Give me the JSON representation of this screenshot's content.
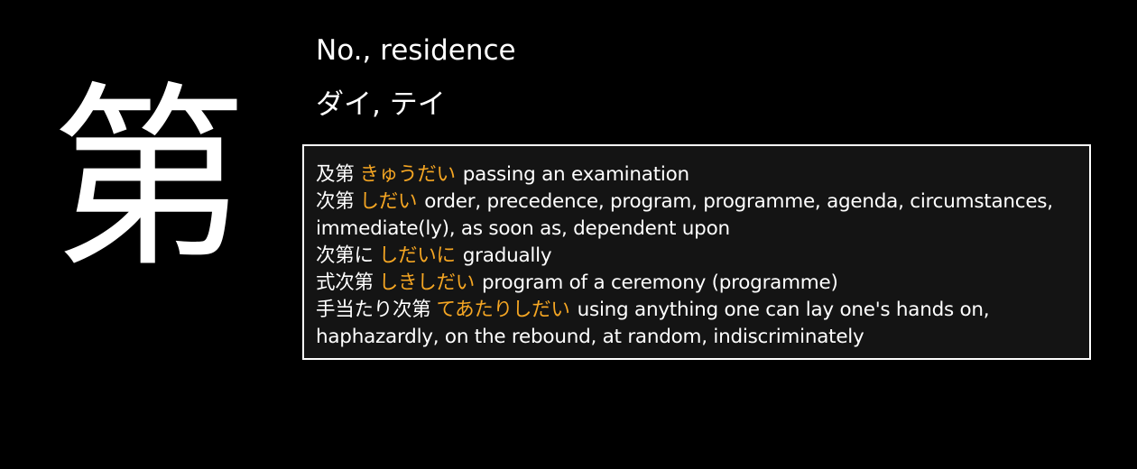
{
  "kanji": "第",
  "meaning": "No., residence",
  "reading": "ダイ, テイ",
  "colors": {
    "background": "#000000",
    "box_background": "#141414",
    "kana": "#f5a623",
    "text": "#ffffff"
  },
  "vocab": [
    {
      "word": "及第",
      "kana": "きゅうだい",
      "gloss": "passing an examination"
    },
    {
      "word": "次第",
      "kana": "しだい",
      "gloss": "order, precedence, program, programme, agenda, circumstances, immediate(ly), as soon as, dependent upon"
    },
    {
      "word": "次第に",
      "kana": "しだいに",
      "gloss": "gradually"
    },
    {
      "word": "式次第",
      "kana": "しきしだい",
      "gloss": "program of a ceremony (programme)"
    },
    {
      "word": "手当たり次第",
      "kana": "てあたりしだい",
      "gloss": "using anything one can lay one's hands on, haphazardly, on the rebound, at random, indiscriminately"
    }
  ]
}
